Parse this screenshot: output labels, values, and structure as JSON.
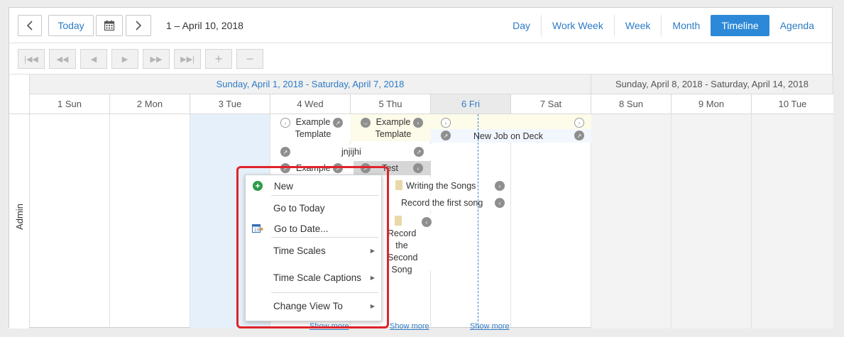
{
  "toolbar": {
    "today_label": "Today",
    "date_range": "1 – April 10, 2018",
    "views": [
      "Day",
      "Work Week",
      "Week",
      "Month",
      "Timeline",
      "Agenda"
    ],
    "active_view": "Timeline"
  },
  "nav_buttons": [
    "|◀◀",
    "◀◀",
    "◀",
    "▶",
    "▶▶",
    "▶▶|",
    "+",
    "−"
  ],
  "weeks": [
    "Sunday, April 1, 2018 - Saturday, April 7, 2018",
    "Sunday, April 8, 2018 - Saturday, April 14, 2018"
  ],
  "days": [
    "1 Sun",
    "2 Mon",
    "3 Tue",
    "4 Wed",
    "5 Thu",
    "6 Fri",
    "7 Sat",
    "8 Sun",
    "9 Mon",
    "10 Tue"
  ],
  "resource": "Admin",
  "appointments": {
    "a1": "Example Template",
    "a2": "Example Template",
    "a3": "New Job on Deck",
    "a4": "jnjijhi",
    "a5": "Example",
    "a6": "Test",
    "a7": "Writing the Songs",
    "a8": "Record the first song",
    "a9": "Record the Second Song"
  },
  "show_more": "Show more",
  "context_menu": {
    "new": "New",
    "go_today": "Go to Today",
    "go_date": "Go to Date...",
    "time_scales": "Time Scales",
    "time_scale_captions": "Time Scale Captions",
    "change_view": "Change View To"
  },
  "colors": {
    "accent": "#2d89d7",
    "link": "#2d7bc4",
    "highlight_box": "#e0242a",
    "selected_day": "#e6f0fa"
  }
}
